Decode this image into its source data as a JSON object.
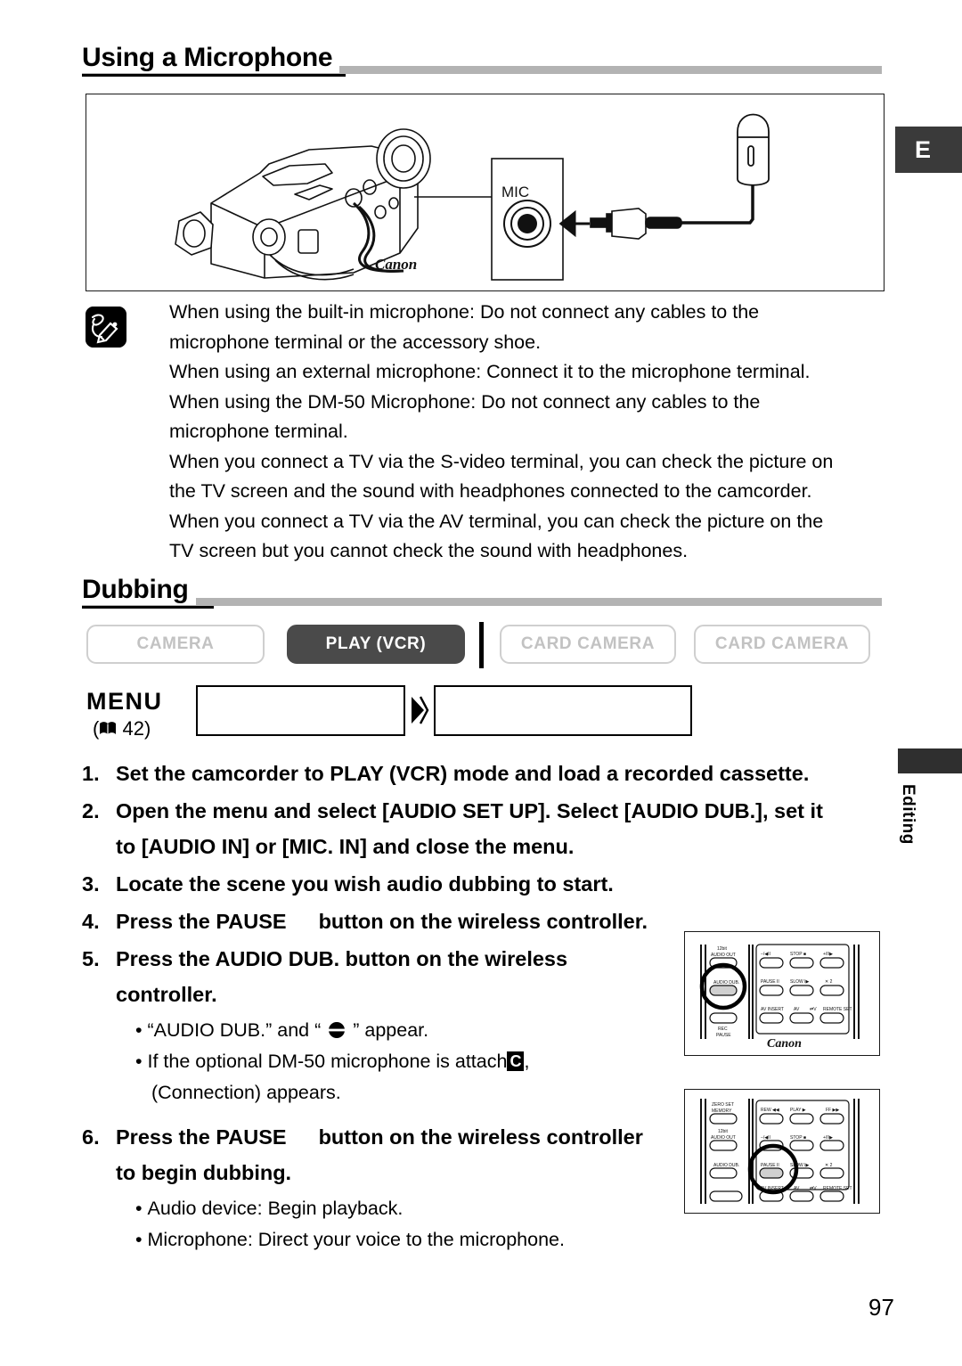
{
  "page": {
    "number": "97",
    "edge_tab_letter": "E",
    "side_tab_label": "Editing"
  },
  "sections": [
    {
      "title": "Using a Microphone"
    },
    {
      "title": "Dubbing"
    }
  ],
  "illustration": {
    "name": "camcorder-mic-connection-diagram",
    "mic_terminal_label": "MIC",
    "brand": "Canon"
  },
  "note": {
    "icon": "notes-pencil-icon",
    "lines": [
      "When using the built-in microphone: Do not connect any cables to the",
      "microphone terminal or the accessory shoe.",
      "When using an external microphone: Connect it to the microphone terminal.",
      "When using the DM-50 Microphone: Do not connect any cables to the",
      "microphone terminal.",
      "When you connect a TV via the S-video terminal, you can check the picture on",
      "the TV screen and the sound with headphones connected to the camcorder.",
      "When you connect a TV via the AV terminal, you can check the picture on the",
      "TV screen but you cannot check the sound with headphones."
    ]
  },
  "mode_buttons": [
    {
      "label": "CAMERA",
      "active": false
    },
    {
      "label": "PLAY (VCR)",
      "active": true
    },
    {
      "label": "CARD CAMERA",
      "active": false
    },
    {
      "label": "CARD CAMERA",
      "active": false
    }
  ],
  "menu_row": {
    "label": "MENU",
    "reference_open": "(",
    "reference_icon": "book-icon",
    "reference_page": "42",
    "reference_close": ")",
    "arrow_icon": "double-chevron-right-icon",
    "box1_value": "",
    "box2_value": ""
  },
  "steps": [
    {
      "num": "1.",
      "lines": [
        "Set the camcorder to PLAY (VCR) mode and load a recorded cassette."
      ]
    },
    {
      "num": "2.",
      "lines": [
        "Open the menu and select [AUDIO SET UP]. Select [AUDIO DUB.], set it",
        "to [AUDIO IN] or [MIC. IN] and close the menu."
      ]
    },
    {
      "num": "3.",
      "lines": [
        "Locate the scene you wish audio dubbing to start."
      ]
    },
    {
      "num": "4.",
      "lines_pre": "Press the PAUSE",
      "lines_post": "button on the wireless controller."
    },
    {
      "num": "5.",
      "lines": [
        "Press the AUDIO DUB. button on the wireless",
        "controller."
      ],
      "bullets": [
        {
          "pre": "“AUDIO DUB.” and “",
          "glyph": "◕",
          "post": "” appear."
        },
        {
          "pre": "If the optional DM-50 microphone is attach",
          "inv": "C",
          "post": ","
        },
        {
          "pre": "(Connection) appears.",
          "indent": true
        }
      ]
    },
    {
      "num": "6.",
      "lines_pre": "Press the PAUSE",
      "lines_post": "button on the wireless controller",
      "line2": "to begin dubbing.",
      "bullets": [
        {
          "pre": "Audio device: Begin playback."
        },
        {
          "pre": "Microphone: Direct your voice to the microphone."
        }
      ]
    }
  ],
  "remote_top": {
    "name": "wireless-controller-audio-dub",
    "highlighted_button": "AUDIO DUB.",
    "labels": [
      "12bit",
      "AUDIO OUT",
      "−/◀II",
      "STOP ■",
      "+/II▶",
      "AUDIO DUB.",
      "PAUSE II",
      "SLOW I▶",
      "× 2",
      "REC PAUSE",
      "AV INSERT",
      "AV",
      "⇄V",
      "REMOTE SET",
      "Canon"
    ]
  },
  "remote_bottom": {
    "name": "wireless-controller-pause",
    "highlighted_button": "PAUSE",
    "labels": [
      "ZERO SET",
      "MEMORY",
      "REW ◀◀",
      "PLAY ▶",
      "FF ▶▶",
      "12bit",
      "AUDIO OUT",
      "−/◀II",
      "STOP ■",
      "+/II▶",
      "AUDIO DUB.",
      "PAUSE II",
      "SLOW I▶",
      "× 2",
      "AV INSERT",
      "AV",
      "⇄V",
      "REMOTE SET"
    ]
  },
  "colors": {
    "rule": "#b3b3b3",
    "active_button": "#4a4a4a",
    "inactive_border": "#cfcfcf",
    "inactive_text": "#c2c2c2",
    "tab": "#3a3a3a"
  }
}
